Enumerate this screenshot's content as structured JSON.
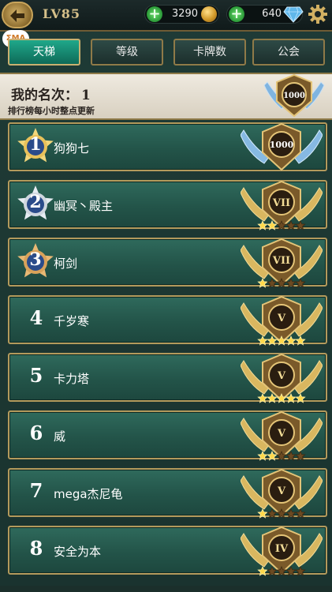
{
  "header": {
    "level": "LV85",
    "gold": "3290",
    "gems": "640"
  },
  "watermark": "ΣMA",
  "tabs": [
    {
      "label": "天梯",
      "active": true
    },
    {
      "label": "等级",
      "active": false
    },
    {
      "label": "卡牌数",
      "active": false
    },
    {
      "label": "公会",
      "active": false
    }
  ],
  "my_rank": {
    "label": "我的名次：",
    "value": "1",
    "note": "排行榜每小时整点更新",
    "rating": "1000"
  },
  "rows": [
    {
      "rank": "1",
      "name": "狗狗七",
      "badge": "1000",
      "stars": 0,
      "medal": "gold"
    },
    {
      "rank": "2",
      "name": "幽冥丶殿主",
      "badge": "VII",
      "stars": 2,
      "medal": "silver"
    },
    {
      "rank": "3",
      "name": "柯剑",
      "badge": "VII",
      "stars": 1,
      "medal": "bronze"
    },
    {
      "rank": "4",
      "name": "千岁寒",
      "badge": "V",
      "stars": 5,
      "medal": null
    },
    {
      "rank": "5",
      "name": "卡力塔",
      "badge": "V",
      "stars": 5,
      "medal": null
    },
    {
      "rank": "6",
      "name": "威",
      "badge": "V",
      "stars": 2,
      "medal": null
    },
    {
      "rank": "7",
      "name": "mega杰尼龟",
      "badge": "V",
      "stars": 1,
      "medal": null
    },
    {
      "rank": "8",
      "name": "安全为本",
      "badge": "IV",
      "stars": 1,
      "medal": null
    }
  ]
}
